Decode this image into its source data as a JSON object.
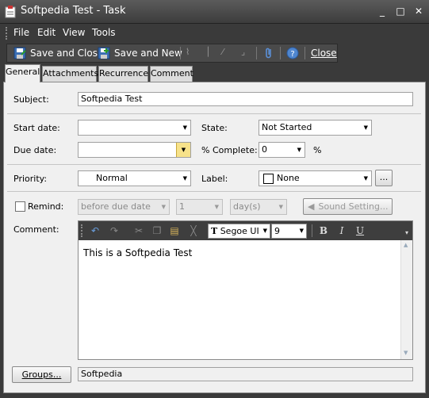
{
  "window": {
    "title": "Softpedia Test - Task",
    "minimize": "_",
    "maximize": "□",
    "close": "✕"
  },
  "menu": {
    "file": "File",
    "edit": "Edit",
    "view": "View",
    "tools": "Tools"
  },
  "toolbar": {
    "save_close": "Save and Close",
    "save_new": "Save and New",
    "close": "Close"
  },
  "tabs": [
    "General",
    "Attachments",
    "Recurrence",
    "Comment"
  ],
  "form": {
    "subject_label": "Subject:",
    "subject_value": "Softpedia Test",
    "start_date_label": "Start date:",
    "start_date_value": "",
    "state_label": "State:",
    "state_value": "Not Started",
    "due_date_label": "Due date:",
    "due_date_value": "",
    "complete_label": "% Complete:",
    "complete_value": "0",
    "percent_sign": "%",
    "priority_label": "Priority:",
    "priority_value": "Normal",
    "label_label": "Label:",
    "label_value": "None",
    "label_more": "...",
    "remind_label": "Remind:",
    "remind_when": "before due date",
    "remind_amount": "1",
    "remind_unit": "day(s)",
    "sound_setting": "Sound Setting...",
    "comment_label": "Comment:",
    "font_name": "Segoe UI",
    "font_size": "9",
    "bold": "B",
    "italic": "I",
    "underline": "U",
    "comment_text": "This is a Softpedia Test",
    "groups_button": "Groups...",
    "groups_value": "Softpedia"
  },
  "colors": {
    "chrome": "#3a3a3a",
    "panel": "#f0f0f0",
    "border": "#8a8a8a"
  }
}
